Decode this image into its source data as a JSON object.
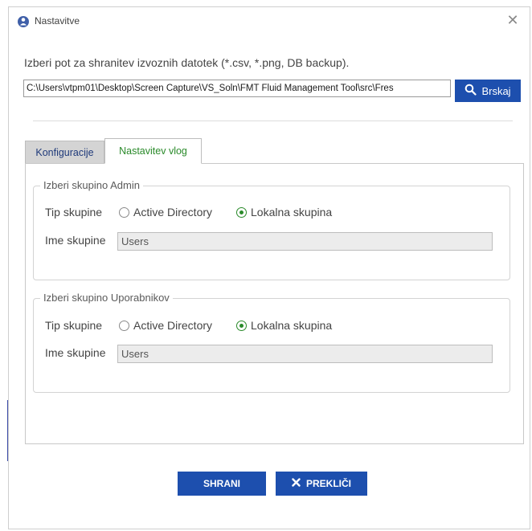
{
  "window": {
    "title": "Nastavitve",
    "close_symbol": "✕"
  },
  "prompt": "Izberi pot za shranitev izvoznih datotek (*.csv, *.png, DB backup).",
  "path": {
    "value": "C:\\Users\\vtpm01\\Desktop\\Screen Capture\\VS_Soln\\FMT Fluid Management Tool\\src\\Fres",
    "browse_label": "Brskaj"
  },
  "tabs": [
    {
      "label": "Konfiguracije",
      "active": false
    },
    {
      "label": "Nastavitev vlog",
      "active": true
    }
  ],
  "admin_group": {
    "legend": "Izberi skupino Admin",
    "type_label": "Tip skupine",
    "option_ad": "Active Directory",
    "option_local": "Lokalna skupina",
    "selected": "Lokalna skupina",
    "name_label": "Ime skupine",
    "name_value": "Users"
  },
  "users_group": {
    "legend": "Izberi skupino Uporabnikov",
    "type_label": "Tip skupine",
    "option_ad": "Active Directory",
    "option_local": "Lokalna skupina",
    "selected": "Lokalna skupina",
    "name_label": "Ime skupine",
    "name_value": "Users"
  },
  "buttons": {
    "save": "SHRANI",
    "cancel": "PREKLIČI"
  },
  "colors": {
    "primary": "#1d4fae",
    "active_tab_text": "#2a8a2a",
    "radio_selected": "#2a8a2a"
  },
  "icons": {
    "app": "settings-app-icon",
    "close": "close-icon",
    "browse": "search-icon",
    "cancel": "x-icon"
  }
}
